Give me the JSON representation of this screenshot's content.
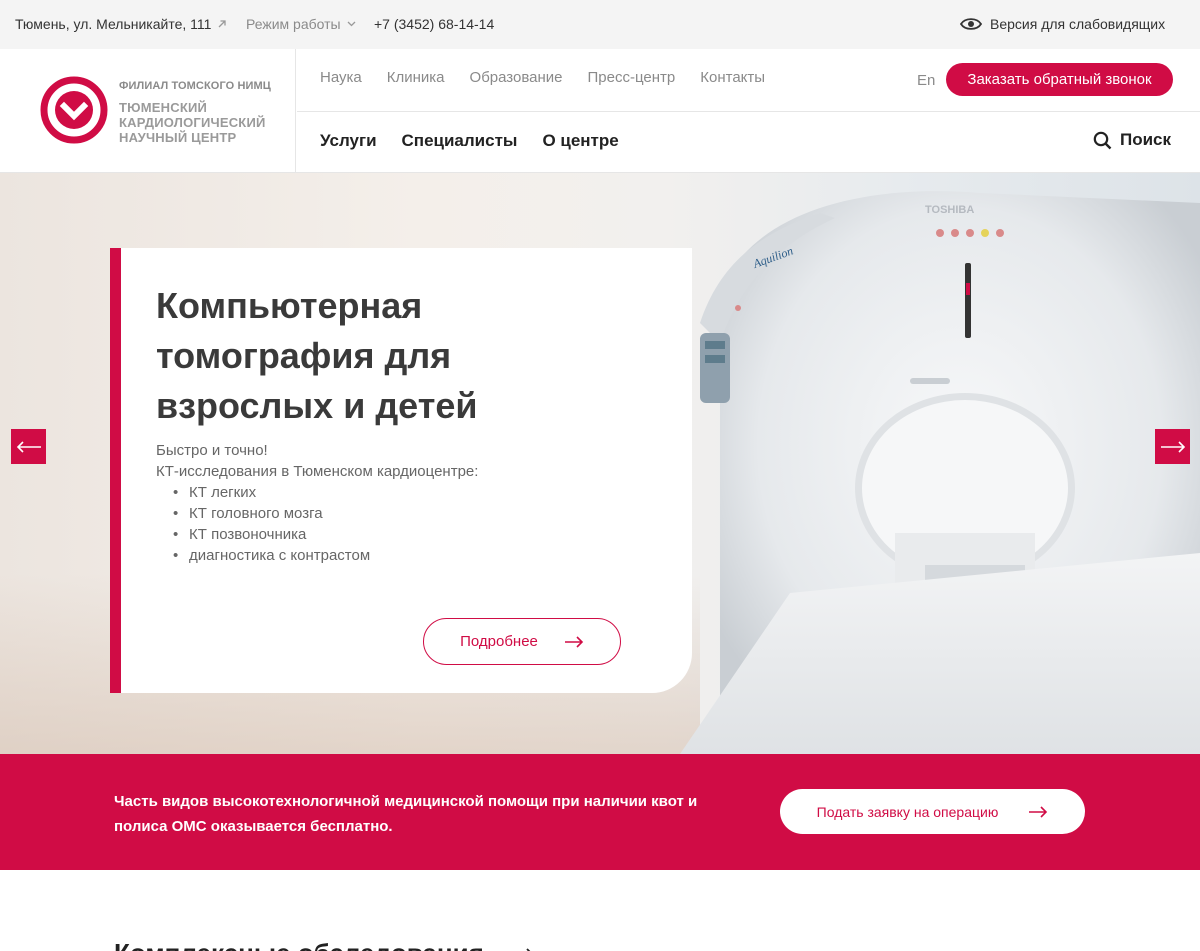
{
  "topbar": {
    "address": "Тюмень, ул. Мельникайте, 111",
    "hours": "Режим работы",
    "phone": "+7 (3452) 68-14-14",
    "low_vision": "Версия для слабовидящих"
  },
  "logo": {
    "line1": "ФИЛИАЛ ТОМСКОГО НИМЦ",
    "line2": "ТЮМЕНСКИЙ",
    "line3": "КАРДИОЛОГИЧЕСКИЙ",
    "line4": "НАУЧНЫЙ ЦЕНТР"
  },
  "nav_top": [
    "Наука",
    "Клиника",
    "Образование",
    "Пресс-центр",
    "Контакты"
  ],
  "nav_main": [
    "Услуги",
    "Специалисты",
    "О центре"
  ],
  "lang": "En",
  "callback_label": "Заказать обратный звонок",
  "search_label": "Поиск",
  "hero": {
    "title": "Компьютерная томография для взрослых и детей",
    "lead1": "Быстро и точно!",
    "lead2": "КТ-исследования в Тюменском кардиоцентре:",
    "items": [
      "КТ легких",
      "КТ головного мозга",
      "КТ позвоночника",
      "диагностика с контрастом"
    ],
    "more_label": "Подробнее",
    "scanner_brand": "TOSHIBA",
    "scanner_model": "Aquilion"
  },
  "band": {
    "text": "Часть видов высокотехнологичной медицинской помощи при наличии квот и полиса ОМС оказывается бесплатно.",
    "button": "Подать заявку на операцию"
  },
  "section_title": "Комплексные обследования",
  "colors": {
    "accent": "#d00c45"
  }
}
